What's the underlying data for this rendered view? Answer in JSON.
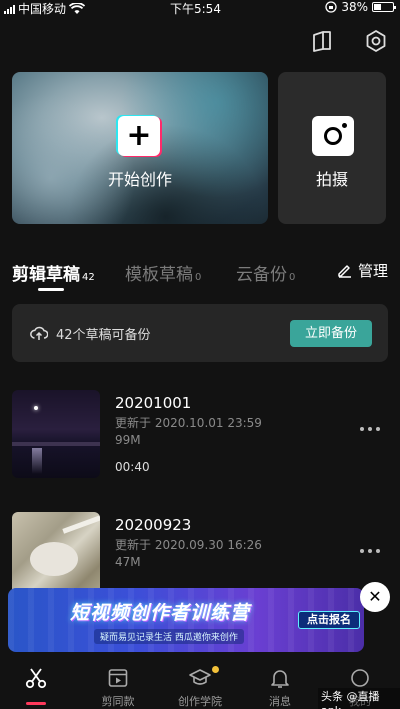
{
  "status_bar": {
    "carrier": "中国移动",
    "time": "下午5:54",
    "battery_percent_text": "38%",
    "battery_level": 0.38
  },
  "top_icons": [
    "tutorial-book-icon",
    "settings-hexagon-icon"
  ],
  "hero": {
    "create_label": "开始创作",
    "shoot_label": "拍摄"
  },
  "tabs": [
    {
      "label": "剪辑草稿",
      "count": "42",
      "active": true
    },
    {
      "label": "模板草稿",
      "count": "0",
      "active": false
    },
    {
      "label": "云备份",
      "count": "0",
      "active": false
    }
  ],
  "manage_label": "管理",
  "backup": {
    "text": "42个草稿可备份",
    "button_label": "立即备份",
    "accent_color": "#3aa59a"
  },
  "drafts": [
    {
      "title": "20201001",
      "updated": "更新于 2020.10.01 23:59",
      "size": "99M",
      "duration": "00:40"
    },
    {
      "title": "20200923",
      "updated": "更新于 2020.09.30 16:26",
      "size": "47M",
      "duration": ""
    }
  ],
  "ad": {
    "title": "短视频创作者训练营",
    "subtitle": "疑而易见记录生活  西瓜邀你来创作",
    "button_label": "点击报名",
    "close_symbol": "✕"
  },
  "bottom_nav": [
    {
      "label": "",
      "icon": "scissors-icon",
      "active": true
    },
    {
      "label": "剪同款",
      "icon": "template-video-icon",
      "active": false
    },
    {
      "label": "创作学院",
      "icon": "graduation-cap-icon",
      "active": false,
      "badge": true
    },
    {
      "label": "消息",
      "icon": "bell-icon",
      "active": false
    },
    {
      "label": "我的",
      "icon": "profile-icon",
      "active": false
    }
  ],
  "watermark": "头条 @直播apk",
  "accent_color": "#ff3a5c"
}
